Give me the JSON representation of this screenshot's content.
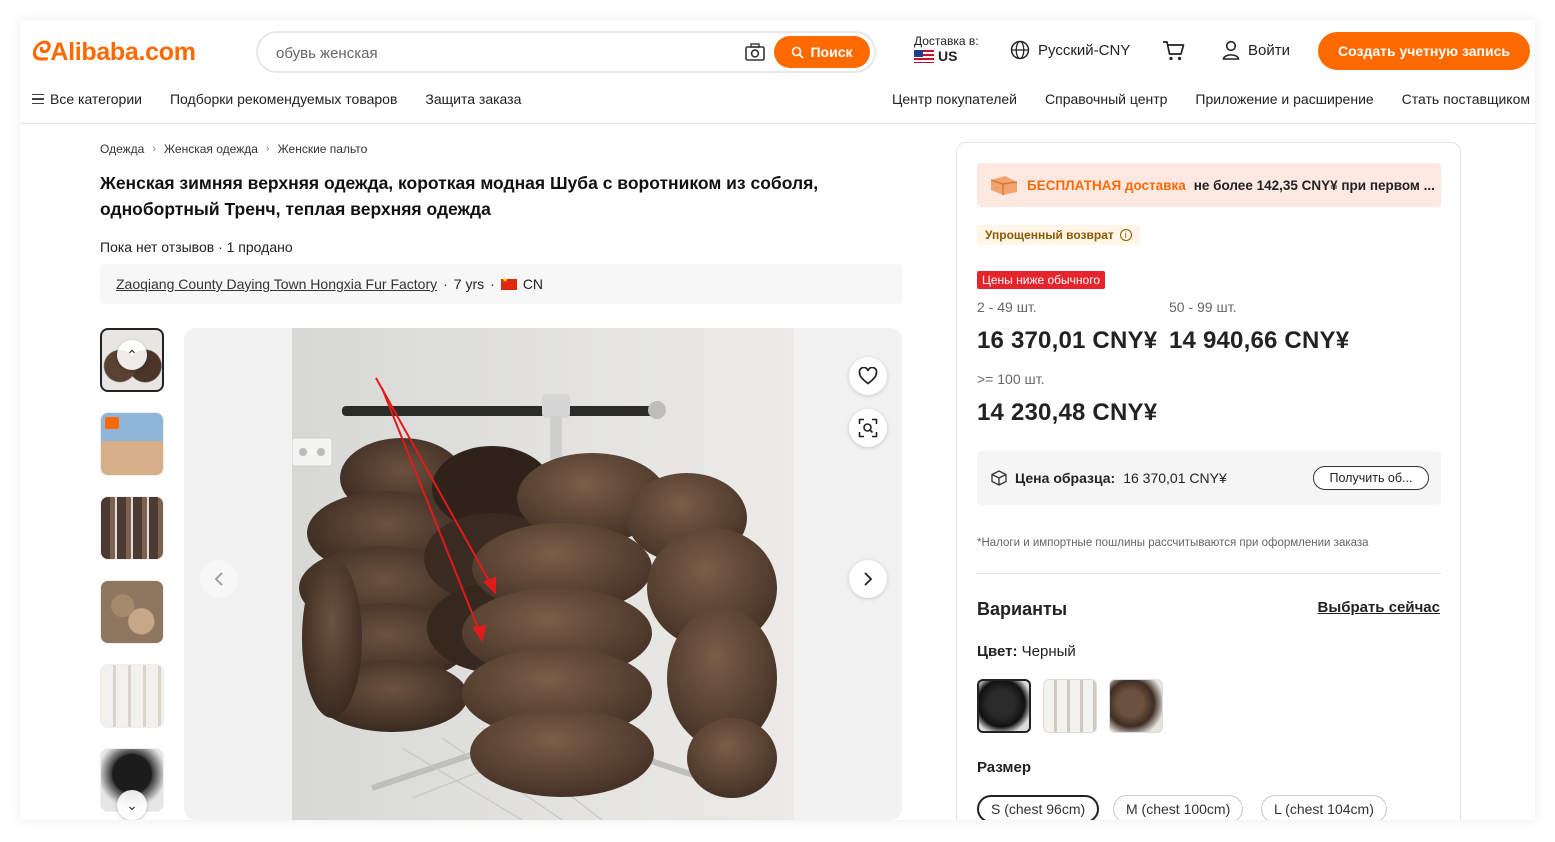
{
  "header": {
    "logo": "Alibaba.com",
    "search_value": "обувь женская",
    "search_button": "Поиск",
    "deliver_to_label": "Доставка в:",
    "deliver_to_country": "US",
    "language": "Русский-CNY",
    "login": "Войти",
    "signup": "Создать учетную запись",
    "accent_color": "#ff6a00"
  },
  "nav": {
    "left": [
      "Все категории",
      "Подборки рекомендуемых товаров",
      "Защита заказа"
    ],
    "right": [
      "Центр покупателей",
      "Справочный центр",
      "Приложение и расширение",
      "Стать поставщиком"
    ]
  },
  "breadcrumb": [
    "Одежда",
    "Женская одежда",
    "Женские пальто"
  ],
  "product": {
    "title": "Женская зимняя верхняя одежда, короткая модная Шуба с воротником из соболя, однобортный Тренч, теплая верхняя одежда",
    "reviews": "Пока нет отзывов · 1 продано",
    "supplier_name": "Zaoqiang County Daying Town Hongxia Fur Factory",
    "supplier_years": "7 yrs",
    "supplier_country": "CN"
  },
  "gallery": {
    "icons": [
      "chevron-up-icon",
      "chevron-down-icon",
      "heart-icon",
      "image-search-icon",
      "chevron-left-icon",
      "chevron-right-icon"
    ]
  },
  "pricing": {
    "free_shipping_highlight": "БЕСПЛАТНАЯ доставка",
    "free_shipping_rest": "не более 142,35 CNY¥ при первом ...",
    "easy_return": "Упрощенный возврат",
    "lower_badge": "Цены ниже обычного",
    "tiers": [
      {
        "qty": "2 - 49 шт.",
        "price": "16 370,01 CNY¥"
      },
      {
        "qty": "50 - 99 шт.",
        "price": "14 940,66 CNY¥"
      },
      {
        "qty": ">= 100 шт.",
        "price": "14 230,48 CNY¥"
      }
    ],
    "sample_label": "Цена образца:",
    "sample_value": "16 370,01 CNY¥",
    "sample_button": "Получить об...",
    "tax_note": "*Налоги и импортные пошлины рассчитываются при оформлении заказа"
  },
  "variants": {
    "heading": "Варианты",
    "choose_now": "Выбрать сейчас",
    "color_label": "Цвет:",
    "color_value": "Черный",
    "size_label": "Размер",
    "sizes": [
      "S (chest 96cm)",
      "M (chest 100cm)",
      "L (chest 104cm)"
    ]
  }
}
